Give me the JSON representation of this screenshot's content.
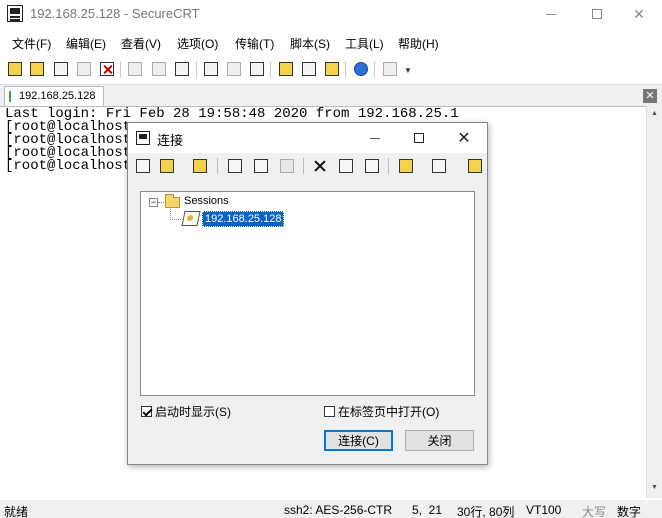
{
  "window": {
    "title": "192.168.25.128 - SecureCRT",
    "min_glyph": "—",
    "max_glyph": "☐",
    "close_glyph": "✕"
  },
  "menu": [
    "文件(F)",
    "编辑(E)",
    "查看(V)",
    "选项(O)",
    "传输(T)",
    "脚本(S)",
    "工具(L)",
    "帮助(H)"
  ],
  "toolbar": {
    "buttons": [
      "connect-icon",
      "quick-connect-icon",
      "connect-tab-icon",
      "reconnect-icon",
      "disconnect-icon",
      "copy-icon",
      "paste-icon",
      "find-icon",
      "print-icon",
      "print-selection-icon",
      "print-setup-icon",
      "session-options-icon",
      "global-options-icon",
      "keymap-icon",
      "help-icon",
      "lock-icon"
    ]
  },
  "tabs": [
    {
      "label": "192.168.25.128",
      "active": true
    }
  ],
  "tab_close_glyph": "✕",
  "terminal": {
    "lines": [
      "Last login: Fri Feb 28 19:58:48 2020 from 192.168.25.1",
      "[root@localhost",
      "[root@localhost",
      "[root@localhost",
      "[root@localhost"
    ]
  },
  "statusbar": {
    "ready": "就绪",
    "protocol": "ssh2: AES-256-CTR",
    "cursor": "5,  21",
    "size": "30行, 80列",
    "emulation": "VT100",
    "caps": "大写",
    "num": "数字"
  },
  "dialog": {
    "title": "连接",
    "close_glyph": "✕",
    "toolbar": [
      "connect-icon",
      "quick-connect-icon",
      "new-folder-icon",
      "cut-icon",
      "copy-icon",
      "paste-icon",
      "delete-icon",
      "properties-icon",
      "find-icon",
      "new-session-icon",
      "desktop-shortcut-icon",
      "help-icon"
    ],
    "tree": {
      "expander": "−",
      "root": "Sessions",
      "items": [
        "192.168.25.128"
      ]
    },
    "show_on_startup": {
      "label": "启动时显示(S)",
      "checked": true
    },
    "open_in_tab": {
      "label": "在标签页中打开(O)",
      "checked": false
    },
    "connect_button": "连接(C)",
    "close_button": "关闭"
  }
}
